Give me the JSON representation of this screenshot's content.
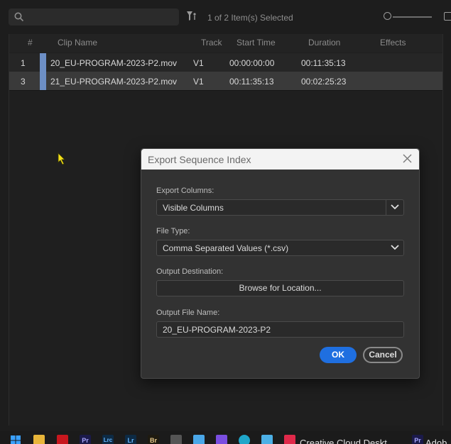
{
  "toolbar": {
    "search_placeholder": "",
    "selected_count": "1 of 2 Item(s) Selected"
  },
  "table": {
    "columns": [
      "#",
      "Clip Name",
      "Track",
      "Start Time",
      "Duration",
      "Effects"
    ],
    "rows": [
      {
        "num": "1",
        "clip": "20_EU-PROGRAM-2023-P2.mov",
        "track": "V1",
        "start": "00:00:00:00",
        "duration": "00:11:35:13",
        "effects": "",
        "label_color": "#6d8fc5"
      },
      {
        "num": "3",
        "clip": "21_EU-PROGRAM-2023-P2.mov",
        "track": "V1",
        "start": "00:11:35:13",
        "duration": "00:02:25:23",
        "effects": "",
        "label_color": "#6d8fc5"
      }
    ]
  },
  "dialog": {
    "title": "Export Sequence Index",
    "export_columns_label": "Export Columns:",
    "export_columns_value": "Visible Columns",
    "file_type_label": "File Type:",
    "file_type_value": "Comma Separated Values (*.csv)",
    "output_destination_label": "Output Destination:",
    "browse_label": "Browse for Location...",
    "output_file_name_label": "Output File Name:",
    "output_file_name_value": "20_EU-PROGRAM-2023-P2",
    "ok_label": "OK",
    "cancel_label": "Cancel"
  },
  "taskbar": {
    "apps": [
      {
        "icon": "windows-start-icon",
        "text": ""
      },
      {
        "icon": "file-explorer-icon",
        "text": ""
      },
      {
        "icon": "acrobat-icon",
        "text": ""
      },
      {
        "icon": "premiere-pro-icon",
        "text": "Pr"
      },
      {
        "icon": "lightroom-classic-icon",
        "text": "Lrc"
      },
      {
        "icon": "lightroom-icon",
        "text": "Lr"
      },
      {
        "icon": "bridge-icon",
        "text": "Br"
      },
      {
        "icon": "settings-app-icon",
        "text": ""
      },
      {
        "icon": "notepad-icon",
        "text": ""
      },
      {
        "icon": "copilot-icon",
        "text": ""
      },
      {
        "icon": "edge-icon",
        "text": ""
      },
      {
        "icon": "photos-app-icon",
        "text": ""
      },
      {
        "icon": "creative-cloud-icon",
        "text": ""
      },
      {
        "icon": "premiere-pro-window-icon",
        "text": "Pr"
      }
    ],
    "creative_cloud_label": "Creative Cloud Deskt",
    "adobe_label": "Adob"
  },
  "colors": {
    "accent": "#1f6fe0",
    "clip_label": "#6d8fc5",
    "dialog_header": "#f3f3f3"
  }
}
